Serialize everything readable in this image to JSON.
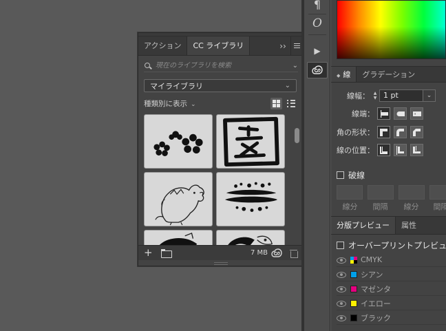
{
  "library_panel": {
    "tabs": [
      {
        "label": "アクション",
        "active": false
      },
      {
        "label": "CC ライブラリ",
        "active": true
      }
    ],
    "collapse_label": "››",
    "search": {
      "placeholder": "現在のライブラリを検索",
      "value": ""
    },
    "library_select": {
      "value": "マイライブラリ"
    },
    "sort_label": "種類別に表示",
    "view_mode": "grid",
    "thumbnails": [
      "flower-stamp",
      "kanji-stamp-zu",
      "boar-illustration",
      "soil-brush-stroke",
      "partial-illustration-1",
      "partial-illustration-2"
    ],
    "footer": {
      "add_label": "+",
      "storage": "7 MB"
    }
  },
  "tool_strip": {
    "tools": [
      "paragraph-icon",
      "opentype-icon",
      "play-icon",
      "cc-libraries-icon"
    ],
    "glyphs": {
      "paragraph": "¶",
      "opentype": "O",
      "play": "▶"
    },
    "active": "cc-libraries-icon"
  },
  "stroke_panel": {
    "tabs": [
      {
        "label": "線",
        "active": true
      },
      {
        "label": "グラデーション",
        "active": false
      }
    ],
    "weight_label": "線幅：",
    "weight_value": "1 pt",
    "cap_label": "線端：",
    "corner_label": "角の形状：",
    "align_label": "線の位置：",
    "dash_label": "破線",
    "dash_fields": [
      "線分",
      "間隔",
      "線分",
      "間隔"
    ]
  },
  "separations_panel": {
    "tabs": [
      {
        "label": "分版プレビュー",
        "active": true
      },
      {
        "label": "属性",
        "active": false
      }
    ],
    "overprint_label": "オーバープリントプレビュー",
    "separations": [
      {
        "name": "CMYK",
        "color": "multi"
      },
      {
        "name": "シアン",
        "color": "#00a0e9"
      },
      {
        "name": "マゼンタ",
        "color": "#e4007f"
      },
      {
        "name": "イエロー",
        "color": "#fff100"
      },
      {
        "name": "ブラック",
        "color": "#000000"
      }
    ]
  },
  "colors": {
    "panel_bg": "#434343",
    "tab_bar": "#383838",
    "canvas_bg": "#595959"
  }
}
